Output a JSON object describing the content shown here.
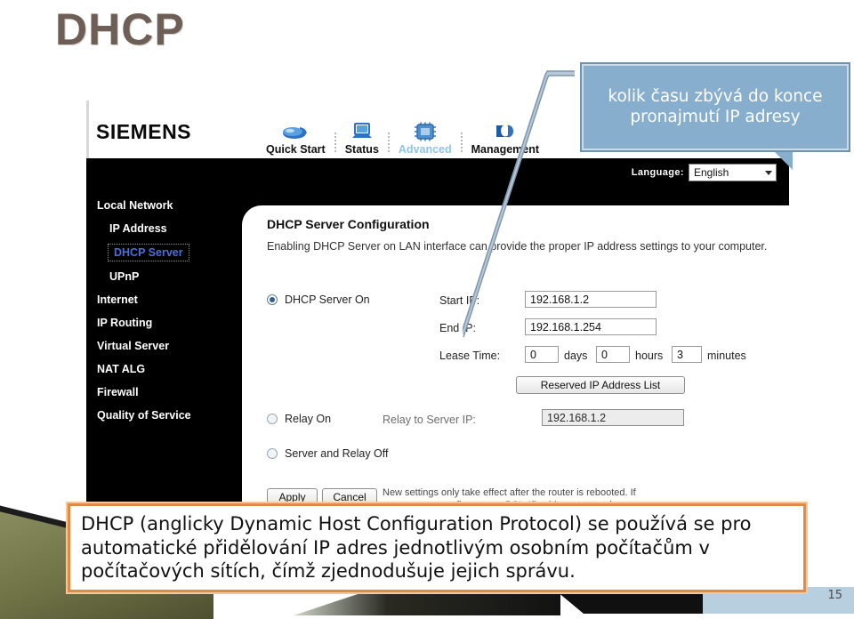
{
  "slide": {
    "title": "DHCP",
    "page_number": "15"
  },
  "callout": {
    "text": "kolik času zbývá do konce pronajmutí IP adresy",
    "bg_color": "#87aecd",
    "border_color": "#6e93af",
    "text_color": "#ffffff"
  },
  "caption": {
    "text": "DHCP (anglicky Dynamic Host Configuration Protocol) se používá se pro automatické přidělování IP adres jednotlivým osobním počítačům v počítačových sítích, čímž zjednodušuje jejich správu.",
    "border_color": "#e08a47"
  },
  "router": {
    "brand": "SIEMENS",
    "nav_tabs": [
      {
        "label": "Quick Start",
        "icon": "mouse-icon",
        "active": false
      },
      {
        "label": "Status",
        "icon": "laptop-icon",
        "active": false
      },
      {
        "label": "Advanced",
        "icon": "chip-icon",
        "active": true
      },
      {
        "label": "Management",
        "icon": "folder-icon",
        "active": false
      }
    ],
    "language": {
      "label": "Language:",
      "value": "English",
      "options": [
        "English"
      ]
    },
    "sidebar": [
      {
        "label": "Local Network",
        "level": 0,
        "selected": false
      },
      {
        "label": "IP Address",
        "level": 1,
        "selected": false
      },
      {
        "label": "DHCP Server",
        "level": 1,
        "selected": true
      },
      {
        "label": "UPnP",
        "level": 1,
        "selected": false
      },
      {
        "label": "Internet",
        "level": 0,
        "selected": false
      },
      {
        "label": "IP Routing",
        "level": 0,
        "selected": false
      },
      {
        "label": "Virtual Server",
        "level": 0,
        "selected": false
      },
      {
        "label": "NAT ALG",
        "level": 0,
        "selected": false
      },
      {
        "label": "Firewall",
        "level": 0,
        "selected": false
      },
      {
        "label": "Quality of Service",
        "level": 0,
        "selected": false
      }
    ],
    "panel": {
      "title": "DHCP Server Configuration",
      "description": "Enabling DHCP Server on LAN interface can provide the proper IP address settings to your computer.",
      "mode_server_on": "DHCP Server On",
      "mode_relay_on": "Relay On",
      "mode_off": "Server and Relay Off",
      "selected_mode": "DHCP Server On",
      "start_ip_label": "Start IP:",
      "start_ip_value": "192.168.1.2",
      "end_ip_label": "End IP:",
      "end_ip_value": "192.168.1.254",
      "lease_time_label": "Lease Time:",
      "lease_days_value": "0",
      "lease_days_unit": "days",
      "lease_hours_value": "0",
      "lease_hours_unit": "hours",
      "lease_minutes_value": "3",
      "lease_minutes_unit": "minutes",
      "reserved_button": "Reserved IP Address List",
      "relay_server_label": "Relay to Server IP:",
      "relay_server_value": "192.168.1.2",
      "apply_button": "Apply",
      "cancel_button": "Cancel",
      "footer_note": "New settings only take effect after the router is rebooted. If necessary, reconfigure your PC's IP address to match new settings."
    }
  }
}
